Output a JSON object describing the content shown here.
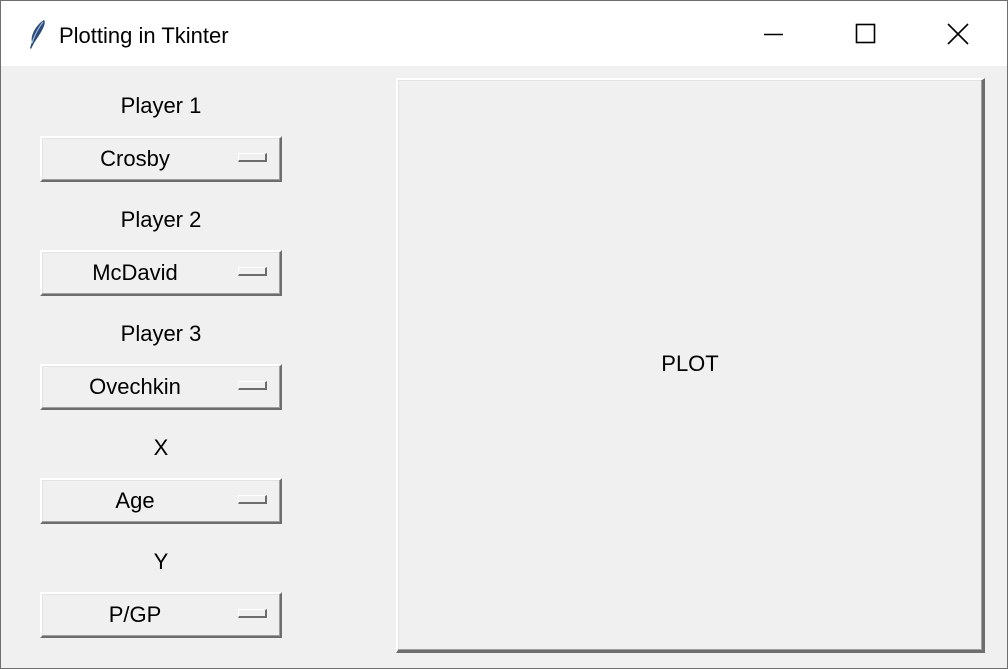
{
  "window": {
    "title": "Plotting in Tkinter",
    "app_icon": "feather-icon",
    "controls": [
      "minimize-icon",
      "maximize-icon",
      "close-icon"
    ]
  },
  "controls": {
    "player1": {
      "label": "Player 1",
      "value": "Crosby"
    },
    "player2": {
      "label": "Player 2",
      "value": "McDavid"
    },
    "player3": {
      "label": "Player 3",
      "value": "Ovechkin"
    },
    "x": {
      "label": "X",
      "value": "Age"
    },
    "y": {
      "label": "Y",
      "value": "P/GP"
    }
  },
  "plot": {
    "label": "PLOT"
  }
}
